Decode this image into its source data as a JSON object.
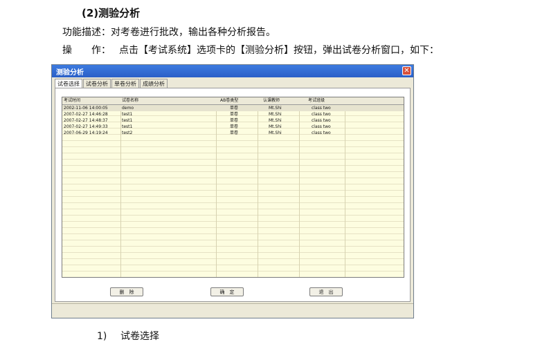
{
  "doc": {
    "heading": "(2)测验分析",
    "func_desc": "功能描述：对考卷进行批改，输出各种分析报告。",
    "op_label": "操　　作：",
    "op_text": "点击【考试系统】选项卡的【测验分析】按钮，弹出试卷分析窗口，如下：",
    "sub_num": "1)",
    "sub_text": "试卷选择"
  },
  "window": {
    "title": "测验分析",
    "close_glyph": "✕",
    "tabs": [
      "试卷选择",
      "试卷分析",
      "单卷分析",
      "成绩分析"
    ],
    "columns": [
      "考试时间",
      "试卷名称",
      "AB卷类型",
      "认课教师",
      "考试班级"
    ],
    "rows": [
      [
        "2002-11-06 14:00:05",
        "demo",
        "单卷",
        "Mt.Shi",
        "class two"
      ],
      [
        "2007-02-27 14:46:28",
        "test1",
        "单卷",
        "Mt.Shi",
        "class two"
      ],
      [
        "2007-02-27 14:48:37",
        "test1",
        "单卷",
        "Mt.Shi",
        "class two"
      ],
      [
        "2007-02-27 14:49:33",
        "test1",
        "单卷",
        "Mt.Shi",
        "class two"
      ],
      [
        "2007-06-29 14:19:24",
        "test2",
        "单卷",
        "Mt.Shi",
        "class two"
      ]
    ],
    "buttons": {
      "delete": "删　除",
      "confirm": "确　定",
      "exit": "退　出"
    }
  }
}
